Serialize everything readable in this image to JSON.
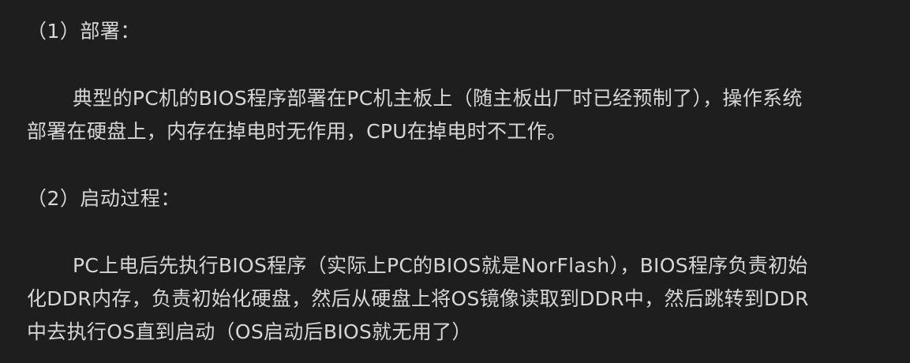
{
  "section1": {
    "heading": "（1）部署：",
    "lines": [
      "典型的PC机的BIOS程序部署在PC机主板上（随主板出厂时已经预制了），操作系统",
      "部署在硬盘上，内存在掉电时无作用，CPU在掉电时不工作。"
    ]
  },
  "section2": {
    "heading": "（2）启动过程：",
    "lines": [
      "PC上电后先执行BIOS程序（实际上PC的BIOS就是NorFlash），BIOS程序负责初始",
      "化DDR内存，负责初始化硬盘，然后从硬盘上将OS镜像读取到DDR中，然后跳转到DDR",
      "中去执行OS直到启动（OS启动后BIOS就无用了）"
    ]
  },
  "colors": {
    "background": "#1e1e1e",
    "text": "#d6d6d6"
  }
}
